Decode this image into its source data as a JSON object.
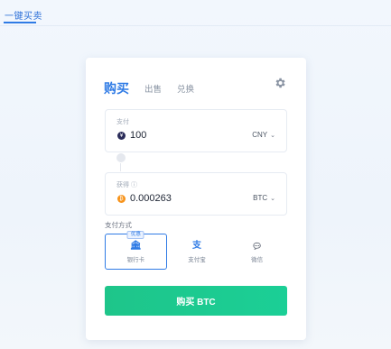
{
  "header": {
    "tab_label": "一键买卖"
  },
  "tabs": [
    {
      "label": "购买",
      "active": true
    },
    {
      "label": "出售",
      "active": false
    },
    {
      "label": "兑换",
      "active": false
    }
  ],
  "settings_icon": "gear-icon",
  "pay": {
    "label": "支付",
    "value": "100",
    "currency": "CNY",
    "coin_icon": "cny-coin-icon"
  },
  "receive": {
    "label": "获得 ⓘ",
    "value": "0.000263",
    "currency": "BTC",
    "coin_icon": "btc-coin-icon"
  },
  "payment": {
    "title": "支付方式",
    "methods": [
      {
        "label": "银行卡",
        "icon": "bank-icon",
        "badge": "优惠",
        "selected": true
      },
      {
        "label": "支付宝",
        "icon": "alipay-icon",
        "selected": false
      },
      {
        "label": "微信",
        "icon": "wechat-icon",
        "selected": false
      }
    ]
  },
  "cta": {
    "label": "购买 BTC"
  },
  "colors": {
    "accent": "#2f7be5",
    "buy_button": "#1ec58a",
    "btc": "#f7931a"
  }
}
